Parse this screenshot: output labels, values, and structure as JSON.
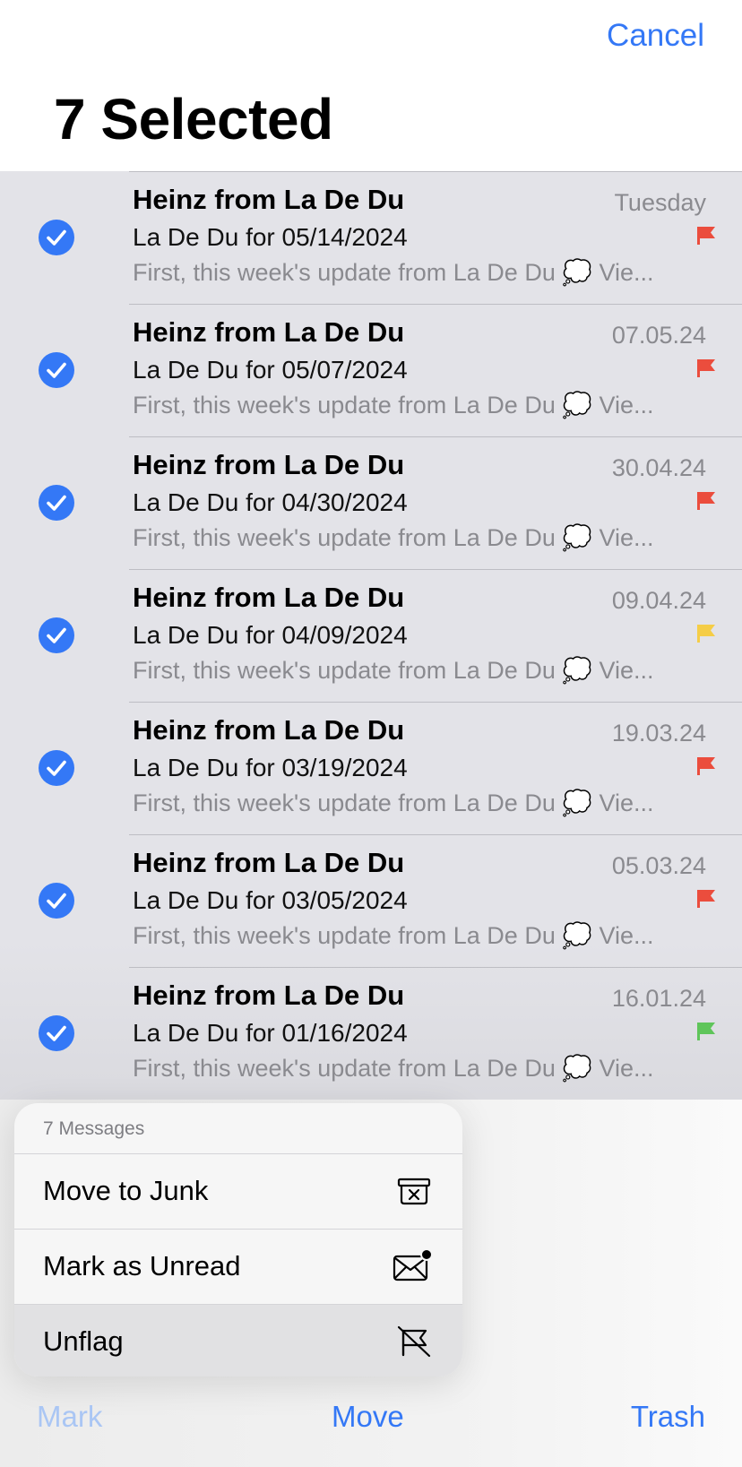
{
  "header": {
    "cancel_label": "Cancel",
    "title": "7 Selected"
  },
  "messages": [
    {
      "sender": "Heinz from La De Du",
      "date": "Tuesday",
      "subject": "La De Du for 05/14/2024",
      "preview": "First, this week's update from La De Du 💭 Vie...",
      "flag_color": "#eb4d3d",
      "selected": true
    },
    {
      "sender": "Heinz from La De Du",
      "date": "07.05.24",
      "subject": "La De Du for 05/07/2024",
      "preview": "First, this week's update from La De Du 💭 Vie...",
      "flag_color": "#eb4d3d",
      "selected": true
    },
    {
      "sender": "Heinz from La De Du",
      "date": "30.04.24",
      "subject": "La De Du for 04/30/2024",
      "preview": "First, this week's update from La De Du 💭 Vie...",
      "flag_color": "#eb4d3d",
      "selected": true
    },
    {
      "sender": "Heinz from La De Du",
      "date": "09.04.24",
      "subject": "La De Du for 04/09/2024",
      "preview": "First, this week's update from La De Du 💭 Vie...",
      "flag_color": "#f5cd47",
      "selected": true
    },
    {
      "sender": "Heinz from La De Du",
      "date": "19.03.24",
      "subject": "La De Du for 03/19/2024",
      "preview": "First, this week's update from La De Du 💭 Vie...",
      "flag_color": "#eb4d3d",
      "selected": true
    },
    {
      "sender": "Heinz from La De Du",
      "date": "05.03.24",
      "subject": "La De Du for 03/05/2024",
      "preview": "First, this week's update from La De Du 💭 Vie...",
      "flag_color": "#eb4d3d",
      "selected": true
    },
    {
      "sender": "Heinz from La De Du",
      "date": "16.01.24",
      "subject": "La De Du for 01/16/2024",
      "preview": "First, this week's update from La De Du 💭 Vie...",
      "flag_color": "#5fc55a",
      "selected": true
    }
  ],
  "menu": {
    "header": "7 Messages",
    "items": [
      {
        "label": "Move to Junk",
        "icon": "junk-bin-icon"
      },
      {
        "label": "Mark as Unread",
        "icon": "envelope-unread-icon"
      },
      {
        "label": "Unflag",
        "icon": "unflag-icon"
      }
    ]
  },
  "toolbar": {
    "mark_label": "Mark",
    "move_label": "Move",
    "trash_label": "Trash"
  },
  "colors": {
    "accent": "#3478f6",
    "accent_disabled": "#aac6f4",
    "flag_red": "#eb4d3d",
    "flag_yellow": "#f5cd47",
    "flag_green": "#5fc55a"
  }
}
